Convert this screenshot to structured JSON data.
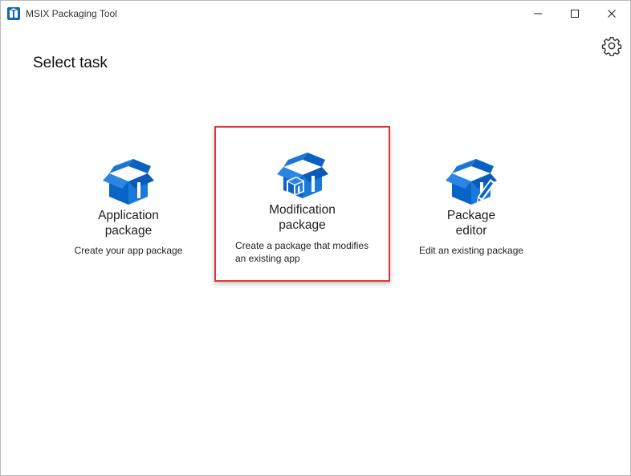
{
  "window": {
    "title": "MSIX Packaging Tool"
  },
  "colors": {
    "accent": "#0a64c8",
    "highlight_border": "#e0343a"
  },
  "page": {
    "heading": "Select task"
  },
  "tasks": [
    {
      "title_line1": "Application",
      "title_line2": "package",
      "description": "Create your app package",
      "icon": "package-box-icon"
    },
    {
      "title_line1": "Modification",
      "title_line2": "package",
      "description": "Create a package that modifies an existing app",
      "icon": "modification-package-icon"
    },
    {
      "title_line1": "Package",
      "title_line2": "editor",
      "description": "Edit an existing package",
      "icon": "package-editor-icon"
    }
  ]
}
